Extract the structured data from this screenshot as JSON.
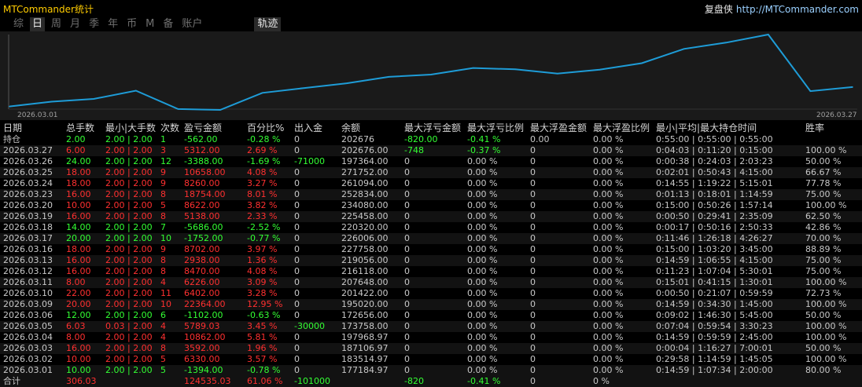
{
  "app": {
    "title": "MTCommander统计",
    "brand_name": "复盘侠",
    "brand_url": "http://MTCommander.com"
  },
  "tabs": [
    {
      "label": "综",
      "active": false
    },
    {
      "label": "日",
      "active": true
    },
    {
      "label": "周",
      "active": false
    },
    {
      "label": "月",
      "active": false
    },
    {
      "label": "季",
      "active": false
    },
    {
      "label": "年",
      "active": false
    },
    {
      "label": "币",
      "active": false
    },
    {
      "label": "M",
      "active": false
    },
    {
      "label": "备",
      "active": false
    },
    {
      "label": "账户",
      "active": false
    },
    {
      "label": "轨迹",
      "active": true
    }
  ],
  "chart": {
    "start_label": "2026.03.01",
    "end_label": "2026.03.27",
    "line_color": "#1e9cd7",
    "background_color": "#1a1a1a"
  },
  "chart_data": {
    "type": "line",
    "x": [
      "2026.03.01",
      "2026.03.02",
      "2026.03.03",
      "2026.03.04",
      "2026.03.05",
      "2026.03.06",
      "2026.03.09",
      "2026.03.10",
      "2026.03.11",
      "2026.03.12",
      "2026.03.13",
      "2026.03.16",
      "2026.03.17",
      "2026.03.18",
      "2026.03.19",
      "2026.03.20",
      "2026.03.23",
      "2026.03.24",
      "2026.03.25",
      "2026.03.26",
      "2026.03.27"
    ],
    "series": [
      {
        "values": [
          177184.97,
          183514.97,
          187106.97,
          197968.97,
          173758.0,
          172656.0,
          195020.0,
          201422.0,
          207648.0,
          216118.0,
          219056.0,
          227758.0,
          226006.0,
          220320.0,
          225458.0,
          234080.0,
          252834.0,
          261094.0,
          271752.0,
          197364.0,
          202676.0
        ]
      }
    ]
  },
  "table": {
    "headers": [
      "日期",
      "总手数",
      "最小|大手数",
      "次数",
      "盈亏金额",
      "百分比%",
      "出入金",
      "余额",
      "最大浮亏金额",
      "最大浮亏比例",
      "最大浮盈金额",
      "最大浮盈比例",
      "最小|平均|最大持仓时间",
      "胜率"
    ],
    "holding": {
      "date": "持仓",
      "lots": "2.00",
      "minmax": "2.00 | 2.00",
      "count": "1",
      "pnl": "-562.00",
      "pct": "-0.28 %",
      "flow": "0",
      "balance": "202676",
      "max_float_loss": "-820.00",
      "max_float_loss_pct": "-0.41 %",
      "max_float_profit": "0.00",
      "max_float_profit_pct": "0.00 %",
      "hold_time": "0:55:00 | 0:55:00 | 0:55:00",
      "winrate": ""
    },
    "rows": [
      {
        "date": "2026.03.27",
        "lots": "6.00",
        "minmax": "2.00 | 2.00",
        "count": "3",
        "pnl": "5312.00",
        "pct": "2.69 %",
        "flow": "0",
        "balance": "202676.00",
        "max_float_loss": "-748",
        "max_float_loss_pct": "-0.37 %",
        "max_float_profit": "0",
        "max_float_profit_pct": "0.00 %",
        "hold_time": "0:04:03 | 0:11:20 | 0:15:00",
        "winrate": "100.00 %",
        "sign": "pos"
      },
      {
        "date": "2026.03.26",
        "lots": "24.00",
        "minmax": "2.00 | 2.00",
        "count": "12",
        "pnl": "-3388.00",
        "pct": "-1.69 %",
        "flow": "-71000",
        "balance": "197364.00",
        "max_float_loss": "0",
        "max_float_loss_pct": "0.00 %",
        "max_float_profit": "0",
        "max_float_profit_pct": "0.00 %",
        "hold_time": "0:00:38 | 0:24:03 | 2:03:23",
        "winrate": "50.00 %",
        "sign": "neg"
      },
      {
        "date": "2026.03.25",
        "lots": "18.00",
        "minmax": "2.00 | 2.00",
        "count": "9",
        "pnl": "10658.00",
        "pct": "4.08 %",
        "flow": "0",
        "balance": "271752.00",
        "max_float_loss": "0",
        "max_float_loss_pct": "0.00 %",
        "max_float_profit": "0",
        "max_float_profit_pct": "0.00 %",
        "hold_time": "0:02:01 | 0:50:43 | 4:15:00",
        "winrate": "66.67 %",
        "sign": "pos"
      },
      {
        "date": "2026.03.24",
        "lots": "18.00",
        "minmax": "2.00 | 2.00",
        "count": "9",
        "pnl": "8260.00",
        "pct": "3.27 %",
        "flow": "0",
        "balance": "261094.00",
        "max_float_loss": "0",
        "max_float_loss_pct": "0.00 %",
        "max_float_profit": "0",
        "max_float_profit_pct": "0.00 %",
        "hold_time": "0:14:55 | 1:19:22 | 5:15:01",
        "winrate": "77.78 %",
        "sign": "pos"
      },
      {
        "date": "2026.03.23",
        "lots": "16.00",
        "minmax": "2.00 | 2.00",
        "count": "8",
        "pnl": "18754.00",
        "pct": "8.01 %",
        "flow": "0",
        "balance": "252834.00",
        "max_float_loss": "0",
        "max_float_loss_pct": "0.00 %",
        "max_float_profit": "0",
        "max_float_profit_pct": "0.00 %",
        "hold_time": "0:01:13 | 0:18:01 | 1:14:59",
        "winrate": "75.00 %",
        "sign": "pos"
      },
      {
        "date": "2026.03.20",
        "lots": "10.00",
        "minmax": "2.00 | 2.00",
        "count": "5",
        "pnl": "8622.00",
        "pct": "3.82 %",
        "flow": "0",
        "balance": "234080.00",
        "max_float_loss": "0",
        "max_float_loss_pct": "0.00 %",
        "max_float_profit": "0",
        "max_float_profit_pct": "0.00 %",
        "hold_time": "0:15:00 | 0:50:26 | 1:57:14",
        "winrate": "100.00 %",
        "sign": "pos"
      },
      {
        "date": "2026.03.19",
        "lots": "16.00",
        "minmax": "2.00 | 2.00",
        "count": "8",
        "pnl": "5138.00",
        "pct": "2.33 %",
        "flow": "0",
        "balance": "225458.00",
        "max_float_loss": "0",
        "max_float_loss_pct": "0.00 %",
        "max_float_profit": "0",
        "max_float_profit_pct": "0.00 %",
        "hold_time": "0:00:50 | 0:29:41 | 2:35:09",
        "winrate": "62.50 %",
        "sign": "pos"
      },
      {
        "date": "2026.03.18",
        "lots": "14.00",
        "minmax": "2.00 | 2.00",
        "count": "7",
        "pnl": "-5686.00",
        "pct": "-2.52 %",
        "flow": "0",
        "balance": "220320.00",
        "max_float_loss": "0",
        "max_float_loss_pct": "0.00 %",
        "max_float_profit": "0",
        "max_float_profit_pct": "0.00 %",
        "hold_time": "0:00:17 | 0:50:16 | 2:50:33",
        "winrate": "42.86 %",
        "sign": "neg"
      },
      {
        "date": "2026.03.17",
        "lots": "20.00",
        "minmax": "2.00 | 2.00",
        "count": "10",
        "pnl": "-1752.00",
        "pct": "-0.77 %",
        "flow": "0",
        "balance": "226006.00",
        "max_float_loss": "0",
        "max_float_loss_pct": "0.00 %",
        "max_float_profit": "0",
        "max_float_profit_pct": "0.00 %",
        "hold_time": "0:11:46 | 1:26:18 | 4:26:27",
        "winrate": "70.00 %",
        "sign": "neg"
      },
      {
        "date": "2026.03.16",
        "lots": "18.00",
        "minmax": "2.00 | 2.00",
        "count": "9",
        "pnl": "8702.00",
        "pct": "3.97 %",
        "flow": "0",
        "balance": "227758.00",
        "max_float_loss": "0",
        "max_float_loss_pct": "0.00 %",
        "max_float_profit": "0",
        "max_float_profit_pct": "0.00 %",
        "hold_time": "0:15:00 | 1:03:20 | 3:45:00",
        "winrate": "88.89 %",
        "sign": "pos"
      },
      {
        "date": "2026.03.13",
        "lots": "16.00",
        "minmax": "2.00 | 2.00",
        "count": "8",
        "pnl": "2938.00",
        "pct": "1.36 %",
        "flow": "0",
        "balance": "219056.00",
        "max_float_loss": "0",
        "max_float_loss_pct": "0.00 %",
        "max_float_profit": "0",
        "max_float_profit_pct": "0.00 %",
        "hold_time": "0:14:59 | 1:06:55 | 4:15:00",
        "winrate": "75.00 %",
        "sign": "pos"
      },
      {
        "date": "2026.03.12",
        "lots": "16.00",
        "minmax": "2.00 | 2.00",
        "count": "8",
        "pnl": "8470.00",
        "pct": "4.08 %",
        "flow": "0",
        "balance": "216118.00",
        "max_float_loss": "0",
        "max_float_loss_pct": "0.00 %",
        "max_float_profit": "0",
        "max_float_profit_pct": "0.00 %",
        "hold_time": "0:11:23 | 1:07:04 | 5:30:01",
        "winrate": "75.00 %",
        "sign": "pos"
      },
      {
        "date": "2026.03.11",
        "lots": "8.00",
        "minmax": "2.00 | 2.00",
        "count": "4",
        "pnl": "6226.00",
        "pct": "3.09 %",
        "flow": "0",
        "balance": "207648.00",
        "max_float_loss": "0",
        "max_float_loss_pct": "0.00 %",
        "max_float_profit": "0",
        "max_float_profit_pct": "0.00 %",
        "hold_time": "0:15:01 | 0:41:15 | 1:30:01",
        "winrate": "100.00 %",
        "sign": "pos"
      },
      {
        "date": "2026.03.10",
        "lots": "22.00",
        "minmax": "2.00 | 2.00",
        "count": "11",
        "pnl": "6402.00",
        "pct": "3.28 %",
        "flow": "0",
        "balance": "201422.00",
        "max_float_loss": "0",
        "max_float_loss_pct": "0.00 %",
        "max_float_profit": "0",
        "max_float_profit_pct": "0.00 %",
        "hold_time": "0:00:50 | 0:21:07 | 0:59:59",
        "winrate": "72.73 %",
        "sign": "pos"
      },
      {
        "date": "2026.03.09",
        "lots": "20.00",
        "minmax": "2.00 | 2.00",
        "count": "10",
        "pnl": "22364.00",
        "pct": "12.95 %",
        "flow": "0",
        "balance": "195020.00",
        "max_float_loss": "0",
        "max_float_loss_pct": "0.00 %",
        "max_float_profit": "0",
        "max_float_profit_pct": "0.00 %",
        "hold_time": "0:14:59 | 0:34:30 | 1:45:00",
        "winrate": "100.00 %",
        "sign": "pos"
      },
      {
        "date": "2026.03.06",
        "lots": "12.00",
        "minmax": "2.00 | 2.00",
        "count": "6",
        "pnl": "-1102.00",
        "pct": "-0.63 %",
        "flow": "0",
        "balance": "172656.00",
        "max_float_loss": "0",
        "max_float_loss_pct": "0.00 %",
        "max_float_profit": "0",
        "max_float_profit_pct": "0.00 %",
        "hold_time": "0:09:02 | 1:46:30 | 5:45:00",
        "winrate": "50.00 %",
        "sign": "neg"
      },
      {
        "date": "2026.03.05",
        "lots": "6.03",
        "minmax": "0.03 | 2.00",
        "count": "4",
        "pnl": "5789.03",
        "pct": "3.45 %",
        "flow": "-30000",
        "balance": "173758.00",
        "max_float_loss": "0",
        "max_float_loss_pct": "0.00 %",
        "max_float_profit": "0",
        "max_float_profit_pct": "0.00 %",
        "hold_time": "0:07:04 | 0:59:54 | 3:30:23",
        "winrate": "100.00 %",
        "sign": "pos"
      },
      {
        "date": "2026.03.04",
        "lots": "8.00",
        "minmax": "2.00 | 2.00",
        "count": "4",
        "pnl": "10862.00",
        "pct": "5.81 %",
        "flow": "0",
        "balance": "197968.97",
        "max_float_loss": "0",
        "max_float_loss_pct": "0.00 %",
        "max_float_profit": "0",
        "max_float_profit_pct": "0.00 %",
        "hold_time": "0:14:59 | 0:59:59 | 2:45:00",
        "winrate": "100.00 %",
        "sign": "pos"
      },
      {
        "date": "2026.03.03",
        "lots": "16.00",
        "minmax": "2.00 | 2.00",
        "count": "8",
        "pnl": "3592.00",
        "pct": "1.96 %",
        "flow": "0",
        "balance": "187106.97",
        "max_float_loss": "0",
        "max_float_loss_pct": "0.00 %",
        "max_float_profit": "0",
        "max_float_profit_pct": "0.00 %",
        "hold_time": "0:00:04 | 1:16:27 | 7:00:01",
        "winrate": "50.00 %",
        "sign": "pos"
      },
      {
        "date": "2026.03.02",
        "lots": "10.00",
        "minmax": "2.00 | 2.00",
        "count": "5",
        "pnl": "6330.00",
        "pct": "3.57 %",
        "flow": "0",
        "balance": "183514.97",
        "max_float_loss": "0",
        "max_float_loss_pct": "0.00 %",
        "max_float_profit": "0",
        "max_float_profit_pct": "0.00 %",
        "hold_time": "0:29:58 | 1:14:59 | 1:45:05",
        "winrate": "100.00 %",
        "sign": "pos"
      },
      {
        "date": "2026.03.01",
        "lots": "10.00",
        "minmax": "2.00 | 2.00",
        "count": "5",
        "pnl": "-1394.00",
        "pct": "-0.78 %",
        "flow": "0",
        "balance": "177184.97",
        "max_float_loss": "0",
        "max_float_loss_pct": "0.00 %",
        "max_float_profit": "0",
        "max_float_profit_pct": "0.00 %",
        "hold_time": "0:14:59 | 1:07:34 | 2:00:00",
        "winrate": "80.00 %",
        "sign": "neg"
      }
    ],
    "total": {
      "date": "合计",
      "lots": "306.03",
      "pnl": "124535.03",
      "pct": "61.06 %",
      "flow": "-101000",
      "max_float_loss": "-820",
      "max_float_loss_pct": "-0.41 %",
      "max_float_profit": "0",
      "max_float_profit_pct": "0 %"
    }
  }
}
